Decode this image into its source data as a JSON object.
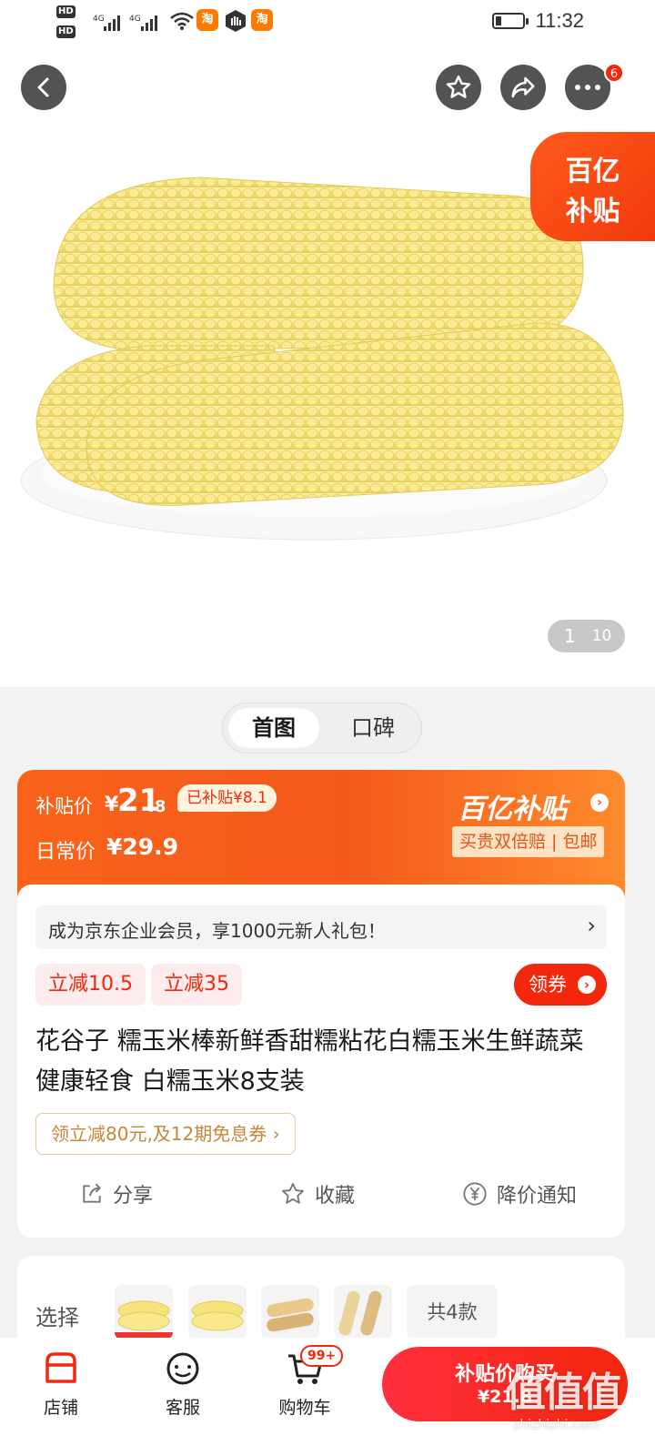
{
  "status_bar": {
    "time": "11:32",
    "hd1": "HD",
    "hd2": "HD",
    "net1": "4G",
    "net2": "4G",
    "app_badge": "淘",
    "app_badge2": "淘"
  },
  "nav": {
    "cart_badge": "6"
  },
  "hero": {
    "subsidy_line1": "百亿",
    "subsidy_line2": "补贴",
    "page_current": "1",
    "page_total": "10"
  },
  "tabs": {
    "active": "首图",
    "other": "口碑"
  },
  "price": {
    "label": "补贴价",
    "currency": "¥",
    "integer": "21",
    "decimal": ".8",
    "subsidy_badge": "已补贴¥8.1",
    "daily_label": "日常价",
    "daily_price": "¥29.9",
    "brand": "百亿补贴",
    "guarantee": "买贵双倍赔 | 包邮"
  },
  "member_banner": {
    "text": "成为京东企业会员，享1000元新人礼包！",
    "arrow": "›"
  },
  "discounts": [
    {
      "label": "立减10.5"
    },
    {
      "label": "立减35"
    }
  ],
  "coupon_button": "领券",
  "title": "花谷子 糯玉米棒新鲜香甜糯粘花白糯玉米生鲜蔬菜 健康轻食 白糯玉米8支装",
  "promo_link": "领立减80元,及12期免息券 ›",
  "actions": {
    "share": "分享",
    "favorite": "收藏",
    "price_alert": "降价通知"
  },
  "select": {
    "label": "选择",
    "count": "共4款"
  },
  "bottom": {
    "shop": "店铺",
    "service": "客服",
    "cart": "购物车",
    "cart_badge": "99+",
    "buy_line1": "补贴价购买",
    "buy_line2": "¥21.8"
  },
  "watermark": {
    "logo": "值值值",
    "url": "zhizhizhi.com"
  },
  "colors": {
    "accent": "#f2270c",
    "orange": "#f9631a",
    "gold": "#c89b5a"
  }
}
